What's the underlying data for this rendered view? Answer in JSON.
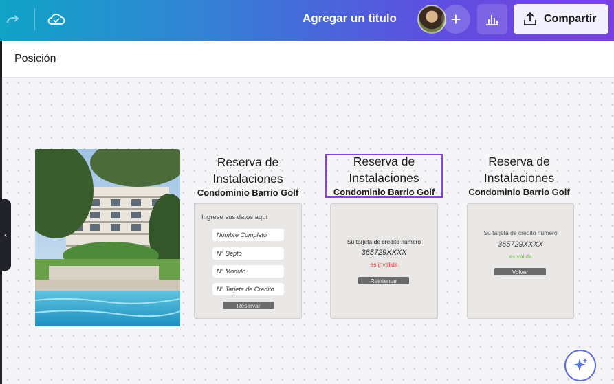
{
  "topbar": {
    "title": "Agregar un título",
    "share_label": "Compartir"
  },
  "header": {
    "position_label": "Posición"
  },
  "cards": [
    {
      "title_line1": "Reserva de",
      "title_line2": "Instalaciones",
      "subtitle": "Condominio Barrio Golf",
      "form_heading": "Ingrese sus datos aquí",
      "fields": [
        "Nombre Completo",
        "N° Depto",
        "N° Modulo",
        "N° Tarjeta de Credito"
      ],
      "button": "Reservar"
    },
    {
      "title_line1": "Reserva de",
      "title_line2": "Instalaciones",
      "subtitle": "Condominio Barrio Golf",
      "line1": "Su tarjeta de credito numero",
      "card_number": "365729XXXX",
      "status": "es invalida",
      "status_color": "#e03030",
      "button": "Reintentar"
    },
    {
      "title_line1": "Reserva de",
      "title_line2": "Instalaciones",
      "subtitle": "Condominio Barrio Golf",
      "line1": "Su tarjeta de credito numero",
      "card_number": "365729XXXX",
      "status": "es valida",
      "status_color": "#63c83a",
      "button": "Volver"
    }
  ],
  "icons": [
    "redo-icon",
    "cloud-saved-icon",
    "plus-icon",
    "stats-icon",
    "upload-icon",
    "chevron-left-icon",
    "magic-sparkle-icon"
  ],
  "colors": {
    "selection": "#8b3dff",
    "share_bg": "#f2efff"
  }
}
